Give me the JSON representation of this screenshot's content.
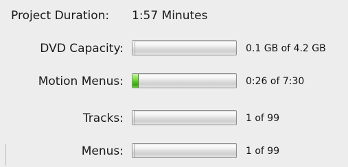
{
  "project_duration": {
    "label": "Project Duration:",
    "value": "1:57 Minutes"
  },
  "meters": [
    {
      "label": "DVD Capacity:",
      "value_text": "0.1 GB of 4.2 GB",
      "fill_fraction": 0.0238
    },
    {
      "label": "Motion Menus:",
      "value_text": "0:26 of 7:30",
      "fill_fraction": 0.0578
    },
    {
      "label": "Tracks:",
      "value_text": "1 of 99",
      "fill_fraction": 0.0101
    },
    {
      "label": "Menus:",
      "value_text": "1 of 99",
      "fill_fraction": 0.0101
    }
  ],
  "colors": {
    "background": "#ededed",
    "meter_fill": "#4fbf1e",
    "meter_border": "#8f8f8f"
  }
}
